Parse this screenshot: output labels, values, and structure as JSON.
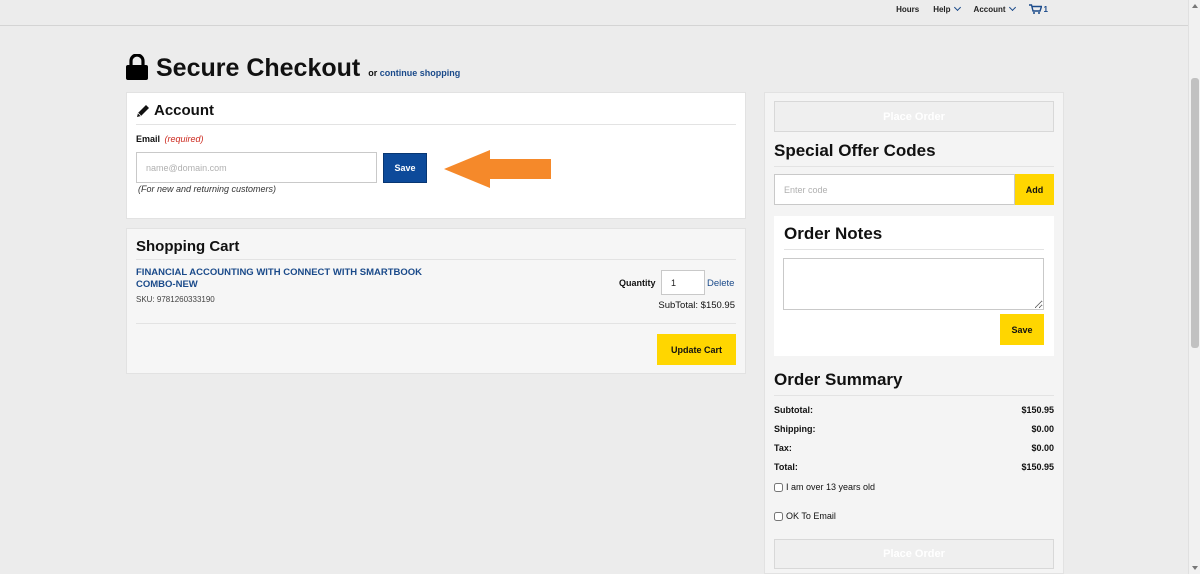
{
  "topnav": {
    "hours": "Hours",
    "help": "Help",
    "account": "Account",
    "cart_count": "1"
  },
  "heading": {
    "title": "Secure Checkout",
    "or": "or",
    "continue_link": "continue shopping"
  },
  "account": {
    "title": "Account",
    "email_label": "Email",
    "required": "(required)",
    "email_placeholder": "name@domain.com",
    "email_value": "",
    "save_label": "Save",
    "hint": "(For new and returning customers)"
  },
  "cart": {
    "title": "Shopping Cart",
    "item": {
      "name_line1": "FINANCIAL ACCOUNTING WITH CONNECT WITH SMARTBOOK",
      "name_line2": "COMBO-NEW",
      "sku": "SKU: 9781260333190",
      "quantity_label": "Quantity",
      "quantity": "1",
      "delete_label": "Delete",
      "subtotal": "SubTotal: $150.95"
    },
    "update_label": "Update Cart"
  },
  "right": {
    "place_order": "Place Order",
    "offer_title": "Special Offer Codes",
    "code_placeholder": "Enter code",
    "add_label": "Add",
    "notes_title": "Order Notes",
    "notes_save": "Save",
    "summary_title": "Order Summary",
    "summary": [
      {
        "label": "Subtotal:",
        "value": "$150.95"
      },
      {
        "label": "Shipping:",
        "value": "$0.00"
      },
      {
        "label": "Tax:",
        "value": "$0.00"
      },
      {
        "label": "Total:",
        "value": "$150.95"
      }
    ],
    "age_check": "I am over 13 years old",
    "email_check": "OK To Email",
    "age_checked": false,
    "email_checked": false
  },
  "colors": {
    "brand_blue": "#0d4a9a",
    "accent_yellow": "#ffd600",
    "required_red": "#cc2a1f",
    "annotation_arrow": "#f5892a"
  }
}
